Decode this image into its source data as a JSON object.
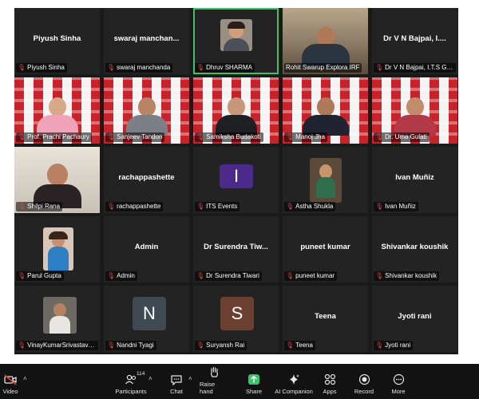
{
  "gallery": {
    "tiles": [
      {
        "display_name": "Piyush Sinha",
        "nameplate": "Piyush Sinha"
      },
      {
        "display_name": "swaraj  manchan...",
        "nameplate": "swaraj manchanda"
      },
      {
        "display_name": "",
        "nameplate": "Dhruv SHARMA"
      },
      {
        "display_name": "",
        "nameplate": "Rohit Swarup Explora IRF"
      },
      {
        "display_name": "Dr V N Bajpai, I....",
        "nameplate": "Dr V N Bajpai, I.T.S Ghaziabad"
      },
      {
        "display_name": "",
        "nameplate": "Prof. Prachi Pachaury"
      },
      {
        "display_name": "",
        "nameplate": "Sanjeev Tandon"
      },
      {
        "display_name": "",
        "nameplate": "Samiksha Budakoti"
      },
      {
        "display_name": "",
        "nameplate": "Manoj Jha"
      },
      {
        "display_name": "",
        "nameplate": "Dr. Uma Gulati"
      },
      {
        "display_name": "",
        "nameplate": "Shilpi Rana"
      },
      {
        "display_name": "rachappashette",
        "nameplate": "rachappashette"
      },
      {
        "display_name": "",
        "nameplate": "ITS Events",
        "letter": "I",
        "letter_color": "#4b2a8c"
      },
      {
        "display_name": "",
        "nameplate": "Astha Shukla"
      },
      {
        "display_name": "Ivan Muñiz",
        "nameplate": "Ivan Muñiz"
      },
      {
        "display_name": "",
        "nameplate": "Parul Gupta"
      },
      {
        "display_name": "Admin",
        "nameplate": "Admin"
      },
      {
        "display_name": "Dr Surendra Tiw...",
        "nameplate": "Dr Surendra Tiwari"
      },
      {
        "display_name": "puneet kumar",
        "nameplate": "puneet kumar"
      },
      {
        "display_name": "Shivankar koushik",
        "nameplate": "Shivankar koushik"
      },
      {
        "display_name": "",
        "nameplate": "VinayKumarSrivastava@ITS-IN"
      },
      {
        "display_name": "",
        "nameplate": "Nandni Tyagi",
        "letter": "N",
        "letter_color": "#3f4a52"
      },
      {
        "display_name": "",
        "nameplate": "Suryansh Rai",
        "letter": "S",
        "letter_color": "#6b4030"
      },
      {
        "display_name": "Teena",
        "nameplate": "Teena"
      },
      {
        "display_name": "Jyoti rani",
        "nameplate": "Jyoti rani"
      }
    ]
  },
  "toolbar": {
    "video_label": "Video",
    "participants_label": "Participants",
    "participants_count": "114",
    "chat_label": "Chat",
    "raise_hand_label": "Raise hand",
    "share_label": "Share",
    "ai_companion_label": "AI Companion",
    "apps_label": "Apps",
    "record_label": "Record",
    "more_label": "More"
  },
  "colors": {
    "accent_green": "#39c46a",
    "mute_red": "#e0433b",
    "toolbar_bg": "#121212",
    "gallery_bg": "#1a1a1a",
    "tile_bg": "#232323"
  }
}
